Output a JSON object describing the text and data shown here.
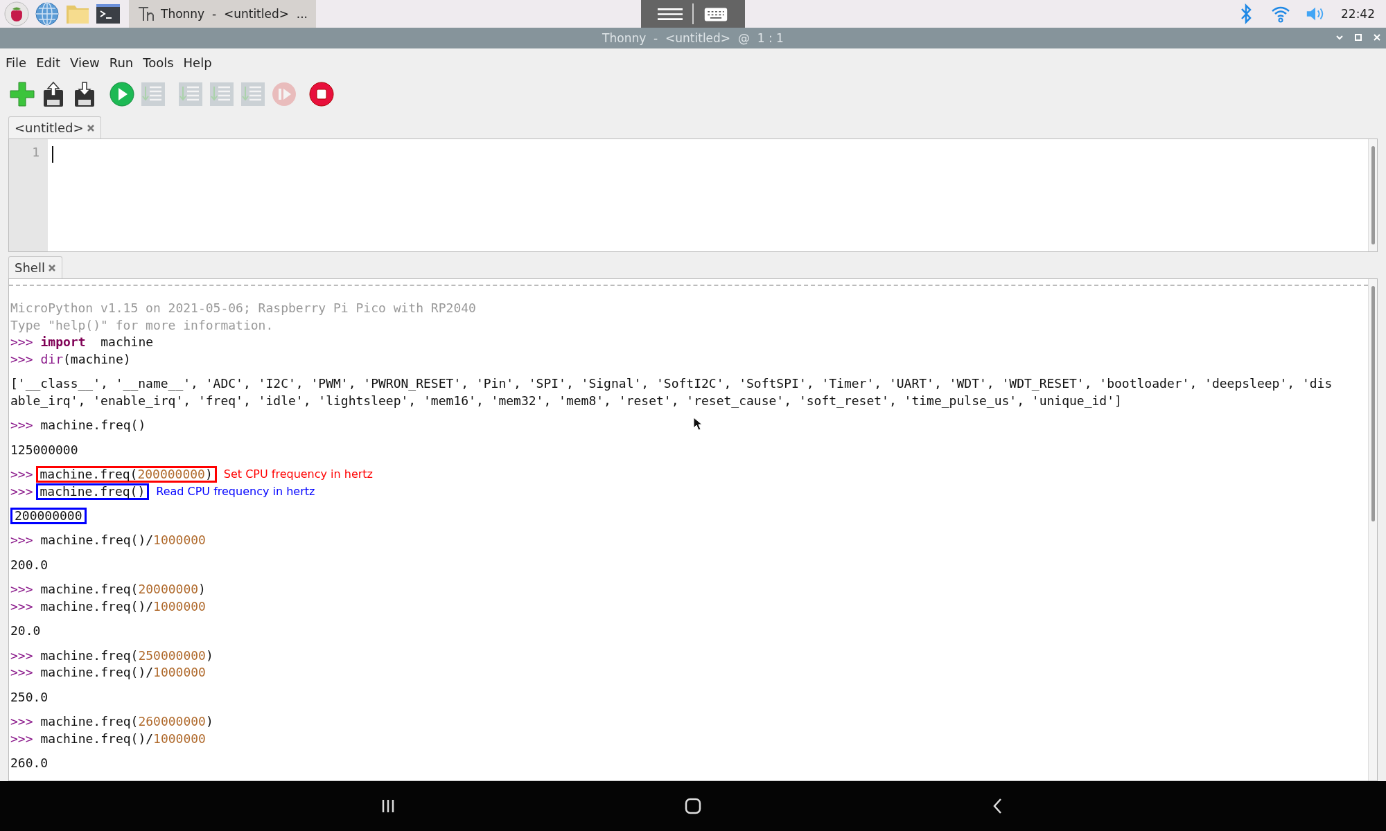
{
  "taskbar": {
    "task": {
      "label": "Thonny  -  <untitled>  ..."
    },
    "clock": "22:42"
  },
  "window": {
    "title": "Thonny  -  <untitled>  @  1 : 1"
  },
  "menu": [
    "File",
    "Edit",
    "View",
    "Run",
    "Tools",
    "Help"
  ],
  "toolbar": [
    {
      "kind": "new",
      "disabled": false
    },
    {
      "kind": "open",
      "disabled": false
    },
    {
      "kind": "save",
      "disabled": false
    },
    {
      "kind": "run",
      "disabled": false
    },
    {
      "kind": "debug",
      "disabled": true
    },
    {
      "kind": "step_over",
      "disabled": true
    },
    {
      "kind": "step_into",
      "disabled": true
    },
    {
      "kind": "step_out",
      "disabled": true
    },
    {
      "kind": "resume",
      "disabled": true
    },
    {
      "kind": "stop",
      "disabled": false
    }
  ],
  "editor": {
    "tab": {
      "label": "<untitled>"
    },
    "line_numbers": [
      "1"
    ]
  },
  "shell": {
    "tab": {
      "label": "Shell"
    },
    "blocks": [
      [
        {
          "segments": [
            {
              "kind": "info",
              "text": "MicroPython v1.15 on 2021-05-06; Raspberry Pi Pico with RP2040"
            }
          ]
        },
        {
          "segments": [
            {
              "kind": "info",
              "text": "Type \"help()\" for more information."
            }
          ]
        },
        {
          "segments": [
            {
              "kind": "prompt",
              "text": ">>>"
            },
            {
              "kind": "keyword",
              "text": "import"
            },
            {
              "kind": "code",
              "text": "  machine"
            }
          ]
        },
        {
          "segments": [
            {
              "kind": "prompt",
              "text": ">>>"
            },
            {
              "kind": "builtin",
              "text": "dir"
            },
            {
              "kind": "code",
              "text": "(machine)"
            }
          ]
        }
      ],
      [
        {
          "segments": [
            {
              "kind": "output",
              "text": "['__class__', '__name__', 'ADC', 'I2C', 'PWM', 'PWRON_RESET', 'Pin', 'SPI', 'Signal', 'SoftI2C', 'SoftSPI', 'Timer', 'UART', 'WDT', 'WDT_RESET', 'bootloader', 'deepsleep', 'dis"
            }
          ]
        },
        {
          "segments": [
            {
              "kind": "output",
              "text": "able_irq', 'enable_irq', 'freq', 'idle', 'lightsleep', 'mem16', 'mem32', 'mem8', 'reset', 'reset_cause', 'soft_reset', 'time_pulse_us', 'unique_id']"
            }
          ]
        }
      ],
      [
        {
          "segments": [
            {
              "kind": "prompt",
              "text": ">>>"
            },
            {
              "kind": "code",
              "text": "machine.freq()"
            }
          ]
        }
      ],
      [
        {
          "segments": [
            {
              "kind": "output",
              "text": "125000000"
            }
          ]
        }
      ],
      [
        {
          "segments": [
            {
              "kind": "prompt",
              "text": ">>>"
            },
            {
              "kind": "code",
              "text": "machine.freq("
            },
            {
              "kind": "number",
              "text": "200000000"
            },
            {
              "kind": "code",
              "text": ")"
            }
          ],
          "annotation": {
            "color": "#ff0000",
            "note": "Set CPU frequency in hertz"
          }
        },
        {
          "segments": [
            {
              "kind": "prompt",
              "text": ">>>"
            },
            {
              "kind": "code",
              "text": "machine.freq()"
            }
          ],
          "annotation": {
            "color": "#0000ff",
            "note": "Read CPU frequency in hertz"
          }
        }
      ],
      [
        {
          "segments": [
            {
              "kind": "output",
              "text": "200000000"
            }
          ],
          "annotation": {
            "color": "#0000ff"
          }
        }
      ],
      [
        {
          "segments": [
            {
              "kind": "prompt",
              "text": ">>>"
            },
            {
              "kind": "code",
              "text": "machine.freq()/"
            },
            {
              "kind": "number",
              "text": "1000000"
            }
          ]
        }
      ],
      [
        {
          "segments": [
            {
              "kind": "output",
              "text": "200.0"
            }
          ]
        }
      ],
      [
        {
          "segments": [
            {
              "kind": "prompt",
              "text": ">>>"
            },
            {
              "kind": "code",
              "text": "machine.freq("
            },
            {
              "kind": "number",
              "text": "20000000"
            },
            {
              "kind": "code",
              "text": ")"
            }
          ]
        },
        {
          "segments": [
            {
              "kind": "prompt",
              "text": ">>>"
            },
            {
              "kind": "code",
              "text": "machine.freq()/"
            },
            {
              "kind": "number",
              "text": "1000000"
            }
          ]
        }
      ],
      [
        {
          "segments": [
            {
              "kind": "output",
              "text": "20.0"
            }
          ]
        }
      ],
      [
        {
          "segments": [
            {
              "kind": "prompt",
              "text": ">>>"
            },
            {
              "kind": "code",
              "text": "machine.freq("
            },
            {
              "kind": "number",
              "text": "250000000"
            },
            {
              "kind": "code",
              "text": ")"
            }
          ]
        },
        {
          "segments": [
            {
              "kind": "prompt",
              "text": ">>>"
            },
            {
              "kind": "code",
              "text": "machine.freq()/"
            },
            {
              "kind": "number",
              "text": "1000000"
            }
          ]
        }
      ],
      [
        {
          "segments": [
            {
              "kind": "output",
              "text": "250.0"
            }
          ]
        }
      ],
      [
        {
          "segments": [
            {
              "kind": "prompt",
              "text": ">>>"
            },
            {
              "kind": "code",
              "text": "machine.freq("
            },
            {
              "kind": "number",
              "text": "260000000"
            },
            {
              "kind": "code",
              "text": ")"
            }
          ]
        },
        {
          "segments": [
            {
              "kind": "prompt",
              "text": ">>>"
            },
            {
              "kind": "code",
              "text": "machine.freq()/"
            },
            {
              "kind": "number",
              "text": "1000000"
            }
          ]
        }
      ],
      [
        {
          "segments": [
            {
              "kind": "output",
              "text": "260.0"
            }
          ]
        }
      ]
    ]
  }
}
